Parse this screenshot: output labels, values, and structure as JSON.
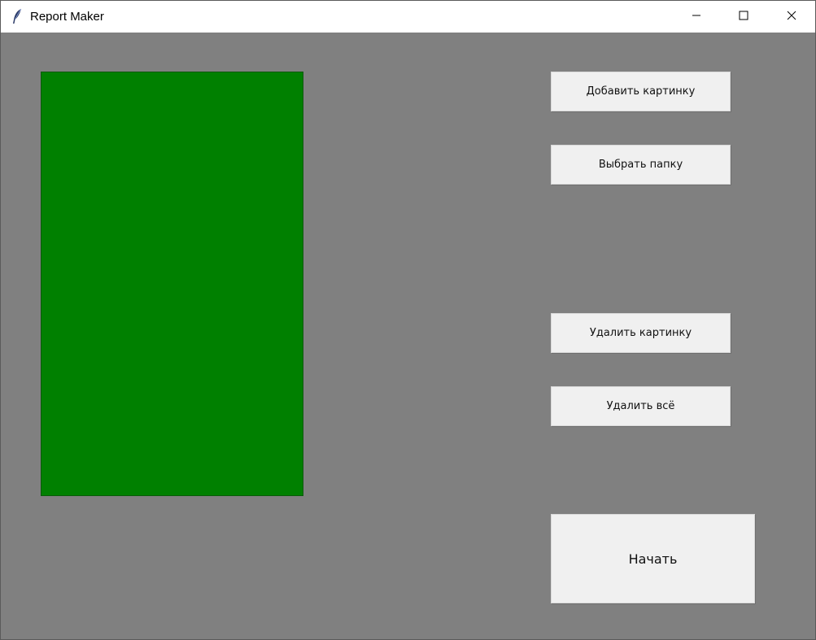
{
  "window": {
    "title": "Report Maker",
    "app_icon": "tk-feather-icon",
    "controls": {
      "minimize_icon": "minimize-icon",
      "maximize_icon": "maximize-icon",
      "close_icon": "close-icon"
    }
  },
  "main": {
    "canvas_color": "#008000",
    "background_color": "#808080"
  },
  "buttons": {
    "add_image": "Добавить картинку",
    "choose_folder": "Выбрать папку",
    "delete_image": "Удалить картинку",
    "delete_all": "Удалить всё",
    "start": "Начать"
  }
}
